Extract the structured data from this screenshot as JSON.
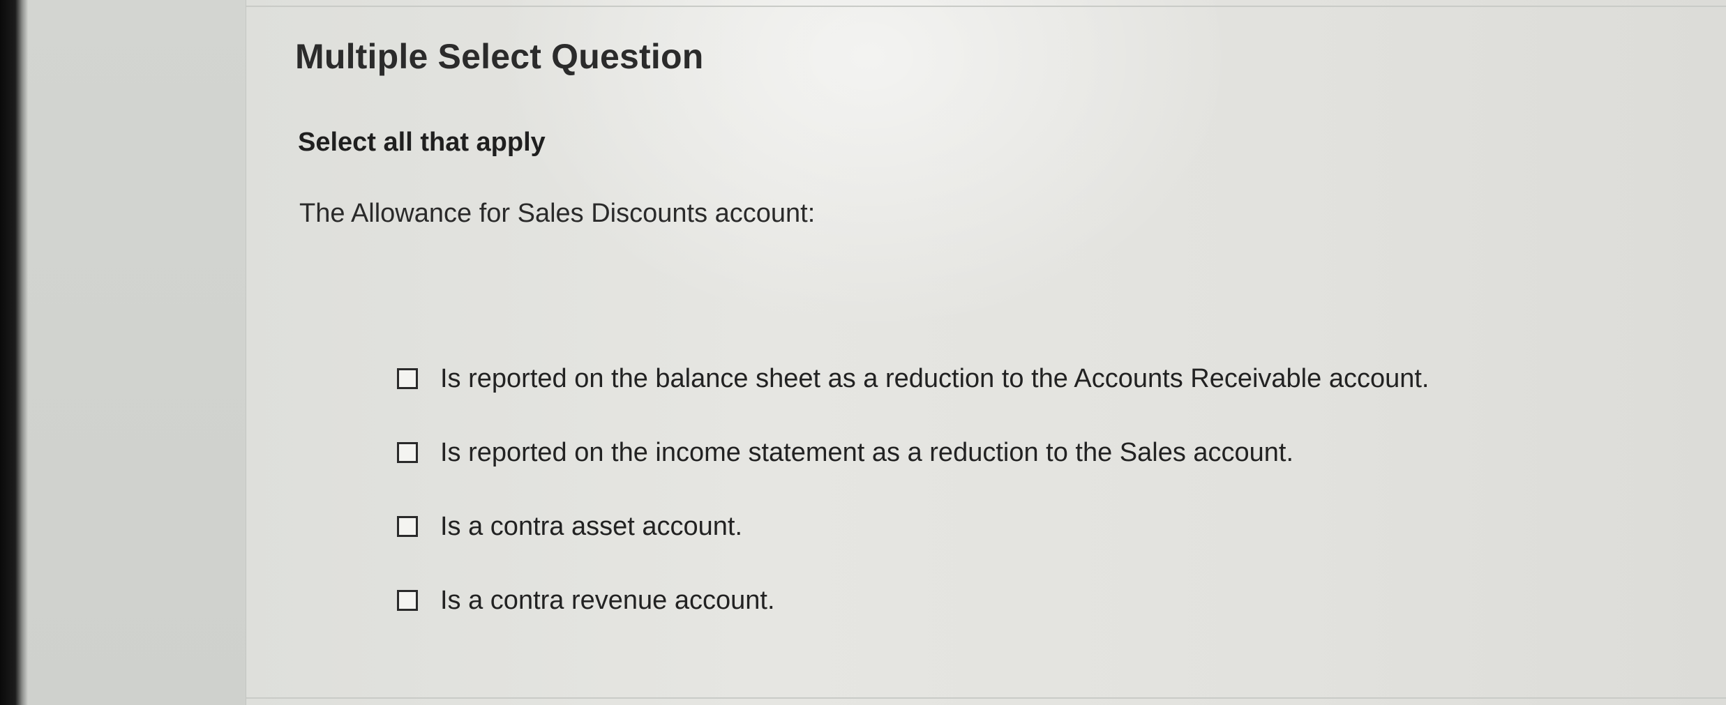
{
  "question": {
    "type_label": "Multiple Select Question",
    "instruction": "Select all that apply",
    "prompt": "The Allowance for Sales Discounts account:"
  },
  "options": [
    {
      "label": "Is reported on the balance sheet as a reduction to the Accounts Receivable account.",
      "checked": false
    },
    {
      "label": "Is reported on the income statement as a reduction to the Sales account.",
      "checked": false
    },
    {
      "label": "Is a contra asset account.",
      "checked": false
    },
    {
      "label": "Is a contra revenue account.",
      "checked": false
    }
  ]
}
